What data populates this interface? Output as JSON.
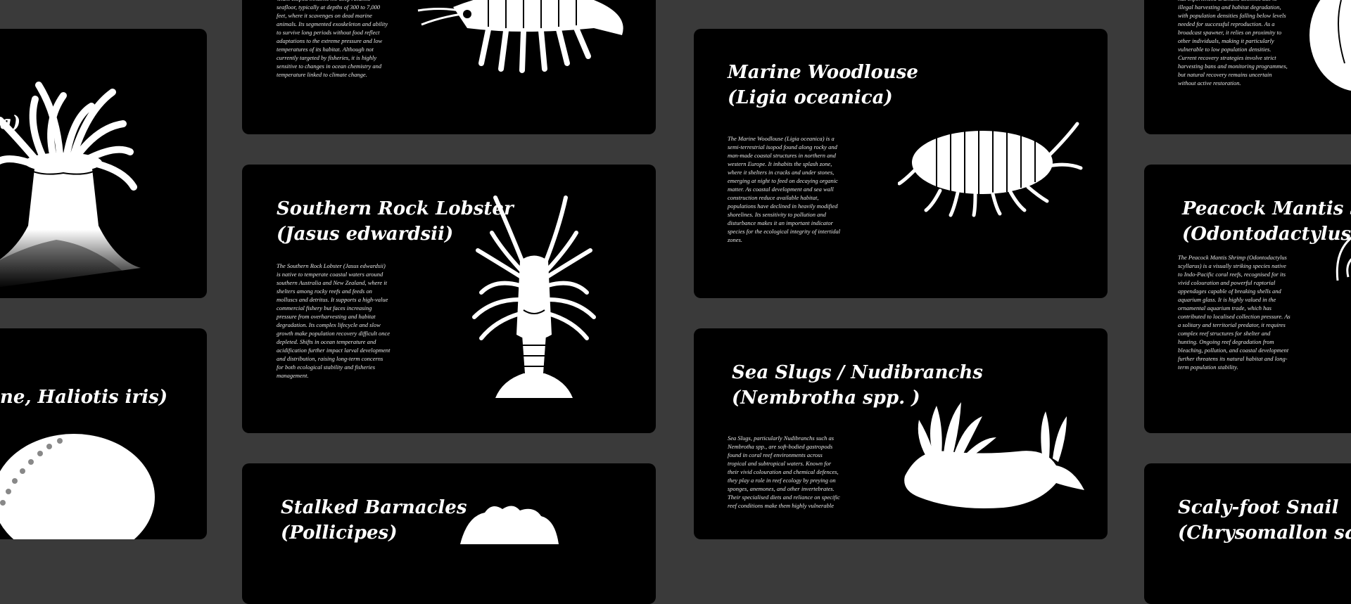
{
  "cards": {
    "anemone": {
      "title_line2": "a)"
    },
    "deep_isopod": {
      "description": "Giant Isopod inhabits the deep Atlantic seafloor, typically at depths of 300 to 7,000 feet, where it scavenges on dead marine animals. Its segmented exoskeleton and ability to survive long periods without food reflect adaptations to the extreme pressure and low temperatures of its habitat. Although not currently targeted by fisheries, it is highly sensitive to changes in ocean chemistry and temperature linked to climate change."
    },
    "marine_woodlouse": {
      "title_line1": "Marine Woodlouse",
      "title_line2": "(Ligia oceanica)",
      "description": "The Marine Woodlouse (Ligia oceanica) is a semi-terrestrial isopod found along rocky and man-made coastal structures in northern and western Europe. It inhabits the splash zone, where it shelters in cracks and under stones, emerging at night to feed on decaying organic matter. As coastal development and sea wall construction reduce available habitat, populations have declined in heavily modified shorelines. Its sensitivity to pollution and disturbance makes it an important indicator species for the ecological integrity of intertidal zones."
    },
    "abalone_partial": {
      "description": "has experienced dramatic declines due to illegal harvesting and habitat degradation, with population densities falling below levels needed for successful reproduction. As a broadcast spawner, it relies on proximity to other individuals, making it particularly vulnerable to low population densities. Current recovery strategies involve strict harvesting bans and monitoring programmes, but natural recovery remains uncertain without active restoration."
    },
    "southern_rock_lobster": {
      "title_line1": "Southern Rock Lobster",
      "title_line2": "(Jasus edwardsii)",
      "description": "The Southern Rock Lobster (Jasus edwardsii) is native to temperate coastal waters around southern Australia and New Zealand, where it shelters among rocky reefs and feeds on molluscs and detritus. It supports a high-value commercial fishery but faces increasing pressure from overharvesting and habitat degradation. Its complex lifecycle and slow growth make population recovery difficult once depleted. Shifts in ocean temperature and acidification further impact larval development and distribution, raising long-term concerns for both ecological stability and fisheries management."
    },
    "paua": {
      "title_line1": "ne, Haliotis iris)"
    },
    "sea_slugs": {
      "title_line1": "Sea Slugs / Nudibranchs",
      "title_line2": "(Nembrotha spp. )",
      "description": "Sea Slugs, particularly Nudibranchs such as Nembrotha spp., are soft-bodied gastropods found in coral reef environments across tropical and subtropical waters. Known for their vivid colouration and chemical defences, they play a role in reef ecology by preying on sponges, anemones, and other invertebrates. Their specialised diets and reliance on specific reef conditions make them highly vulnerable"
    },
    "peacock_mantis": {
      "title_line1": "Peacock Mantis Shrimp",
      "title_line2": "(Odontodactylus scyllarus)",
      "description": "The Peacock Mantis Shrimp (Odontodactylus scyllarus) is a visually striking species native to Indo-Pacific coral reefs, recognised for its vivid colouration and powerful raptorial appendages capable of breaking shells and aquarium glass. It is highly valued in the ornamental aquarium trade, which has contributed to localised collection pressure. As a solitary and territorial predator, it requires complex reef structures for shelter and hunting. Ongoing reef degradation from bleaching, pollution, and coastal development further threatens its natural habitat and long-term population stability."
    },
    "stalked_barnacles": {
      "title_line1": "Stalked Barnacles",
      "title_line2": "(Pollicipes)"
    },
    "scaly_foot_snail": {
      "title_line1": "Scaly-foot Snail",
      "title_line2": "(Chrysomallon squamiferum)"
    }
  },
  "colors": {
    "background": "#3a3a3a",
    "card": "#000000",
    "text": "#ffffff",
    "illustration": "#ffffff"
  }
}
